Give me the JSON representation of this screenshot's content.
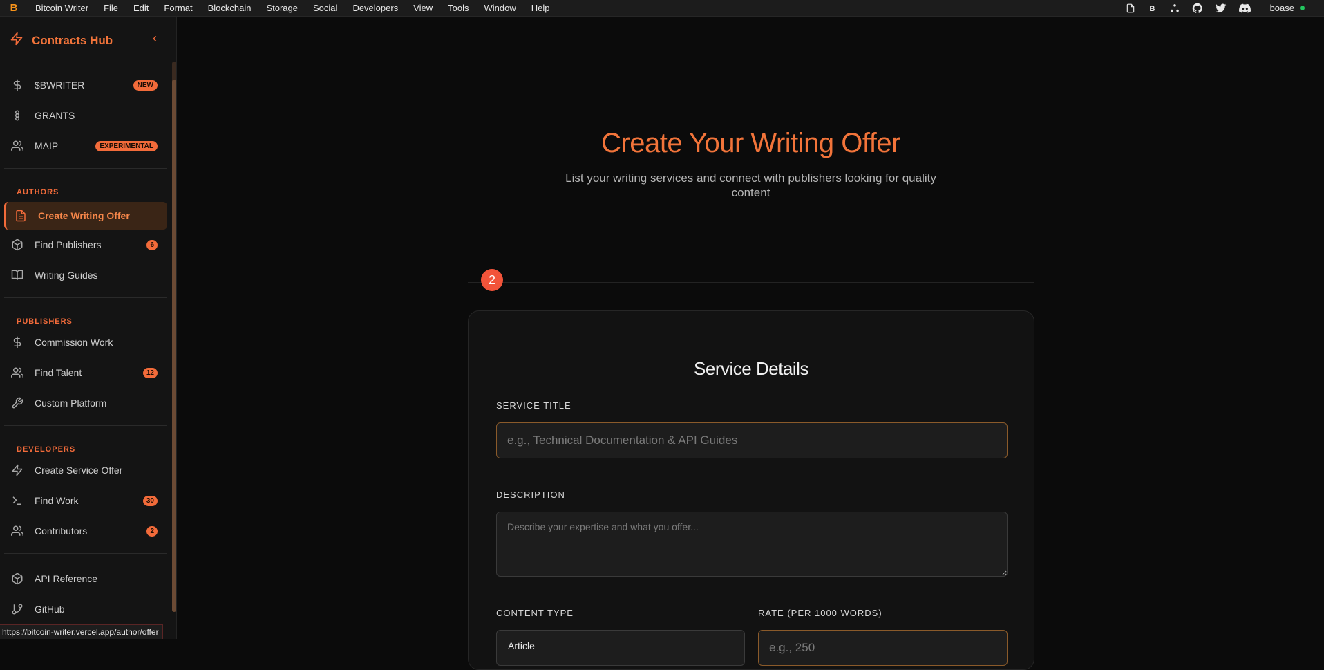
{
  "menubar": {
    "logo": "B",
    "items": [
      "Bitcoin Writer",
      "File",
      "Edit",
      "Format",
      "Blockchain",
      "Storage",
      "Social",
      "Developers",
      "View",
      "Tools",
      "Window",
      "Help"
    ],
    "user": "boase",
    "status_color": "#22c55e"
  },
  "sidebar": {
    "title": "Contracts Hub",
    "top_items": [
      {
        "label": "$BWRITER",
        "badge": "NEW",
        "icon": "dollar-icon"
      },
      {
        "label": "GRANTS",
        "badge": "",
        "icon": "grants-icon"
      },
      {
        "label": "MAIP",
        "badge": "EXPERIMENTAL",
        "icon": "users-icon"
      }
    ],
    "authors": {
      "heading": "AUTHORS",
      "items": [
        {
          "label": "Create Writing Offer",
          "badge": "",
          "icon": "document-icon",
          "active": true
        },
        {
          "label": "Find Publishers",
          "badge": "6",
          "icon": "box-icon"
        },
        {
          "label": "Writing Guides",
          "badge": "",
          "icon": "book-icon"
        }
      ]
    },
    "publishers": {
      "heading": "PUBLISHERS",
      "items": [
        {
          "label": "Commission Work",
          "badge": "",
          "icon": "dollar-icon"
        },
        {
          "label": "Find Talent",
          "badge": "12",
          "icon": "users-icon"
        },
        {
          "label": "Custom Platform",
          "badge": "",
          "icon": "wrench-icon"
        }
      ]
    },
    "developers": {
      "heading": "DEVELOPERS",
      "items": [
        {
          "label": "Create Service Offer",
          "badge": "",
          "icon": "lightning-icon"
        },
        {
          "label": "Find Work",
          "badge": "30",
          "icon": "terminal-icon"
        },
        {
          "label": "Contributors",
          "badge": "2",
          "icon": "users-icon"
        }
      ]
    },
    "bottom_items": [
      {
        "label": "API Reference",
        "icon": "box-icon"
      },
      {
        "label": "GitHub",
        "icon": "git-branch-icon"
      }
    ]
  },
  "statusbar": {
    "url": "https://bitcoin-writer.vercel.app/author/offer"
  },
  "main": {
    "title": "Create Your Writing Offer",
    "subtitle": "List your writing services and connect with publishers looking for quality content",
    "step": "2",
    "card": {
      "title": "Service Details",
      "service_title_label": "SERVICE TITLE",
      "service_title_placeholder": "e.g., Technical Documentation & API Guides",
      "description_label": "DESCRIPTION",
      "description_placeholder": "Describe your expertise and what you offer...",
      "content_type_label": "CONTENT TYPE",
      "content_type_value": "Article",
      "rate_label": "RATE (PER 1000 WORDS)",
      "rate_placeholder": "e.g., 250"
    }
  },
  "colors": {
    "accent": "#f26b3a",
    "background": "#0b0b0b",
    "sidebar": "#141414"
  }
}
